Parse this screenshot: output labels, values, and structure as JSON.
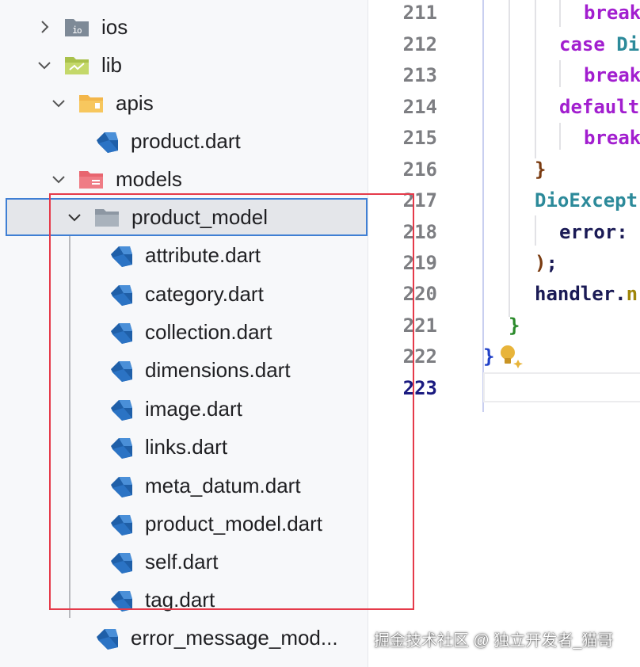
{
  "colors": {
    "accent": "#3f7fd4",
    "annotation_box": "#e53a4a",
    "dart_icon": "#1f5fa8",
    "folder_grey": "#7e8a97",
    "folder_green": "#a9c14b",
    "folder_orange": "#f3b64a",
    "folder_red": "#e8656f",
    "keyword": "#a21ecf",
    "type": "#2c8a9a"
  },
  "tree": {
    "ios": {
      "label": "ios",
      "icon": "ios-folder-icon",
      "expanded": false
    },
    "lib": {
      "label": "lib",
      "icon": "green-folder-icon",
      "expanded": true
    },
    "apis": {
      "label": "apis",
      "icon": "orange-folder-icon",
      "expanded": true
    },
    "apis_product": {
      "label": "product.dart",
      "icon": "dart-file-icon"
    },
    "models": {
      "label": "models",
      "icon": "red-folder-icon",
      "expanded": true
    },
    "product_model": {
      "label": "product_model",
      "icon": "grey-folder-icon",
      "expanded": true,
      "selected": true
    },
    "files": [
      {
        "label": "attribute.dart"
      },
      {
        "label": "category.dart"
      },
      {
        "label": "collection.dart"
      },
      {
        "label": "dimensions.dart"
      },
      {
        "label": "image.dart"
      },
      {
        "label": "links.dart"
      },
      {
        "label": "meta_datum.dart"
      },
      {
        "label": "product_model.dart"
      },
      {
        "label": "self.dart"
      },
      {
        "label": "tag.dart"
      }
    ],
    "error_message": {
      "label": "error_message_mod...",
      "icon": "dart-file-icon"
    }
  },
  "editor": {
    "line_numbers": [
      "211",
      "212",
      "213",
      "214",
      "215",
      "216",
      "217",
      "218",
      "219",
      "220",
      "221",
      "222",
      "223"
    ],
    "current_line": "223",
    "code": {
      "l211": "break",
      "l212_kw": "case",
      "l212_ty": "Di",
      "l213": "break",
      "l214": "default",
      "l215": "break",
      "l216": "}",
      "l217": "DioExcept",
      "l218": "error:",
      "l219_paren": ")",
      "l219_semi": ";",
      "l220_obj": "handler.",
      "l220_m": "n",
      "l221": "}",
      "l222": "}"
    }
  },
  "watermark": "掘金技术社区 @ 独立开发者_猫哥"
}
